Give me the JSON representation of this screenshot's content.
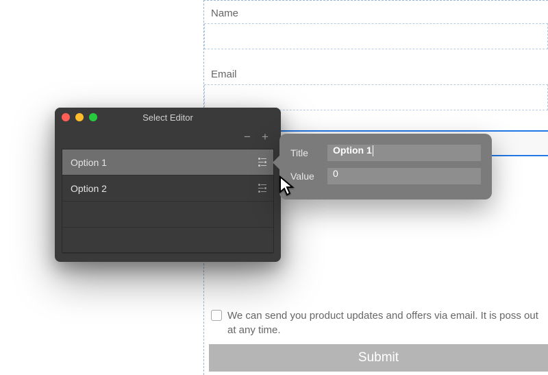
{
  "form": {
    "name_label": "Name",
    "email_label": "Email",
    "checkbox_text": "We can send you product updates and offers via email. It is poss out at any time.",
    "submit_label": "Submit"
  },
  "editor": {
    "window_title": "Select Editor",
    "options": [
      {
        "label": "Option 1"
      },
      {
        "label": "Option 2"
      }
    ]
  },
  "popover": {
    "title_label": "Title",
    "title_value": "Option 1",
    "value_label": "Value",
    "value_value": "0"
  }
}
